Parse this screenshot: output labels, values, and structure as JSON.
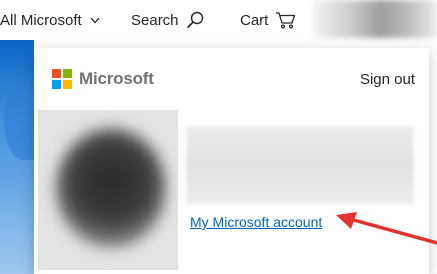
{
  "nav": {
    "all_microsoft": "All Microsoft",
    "search": "Search",
    "cart": "Cart"
  },
  "panel": {
    "brand": "Microsoft",
    "sign_out": "Sign out",
    "account_link": "My Microsoft account"
  },
  "colors": {
    "logo_red": "#f25022",
    "logo_green": "#7fba00",
    "logo_blue": "#00a4ef",
    "logo_yellow": "#ffb900",
    "link_blue": "#0067b8",
    "annotation_red": "#e0332e"
  },
  "icons": {
    "dropdown": "chevron-down-icon",
    "search": "search-icon",
    "cart": "cart-icon",
    "logo": "microsoft-logo-icon",
    "annotation": "arrow-icon"
  }
}
